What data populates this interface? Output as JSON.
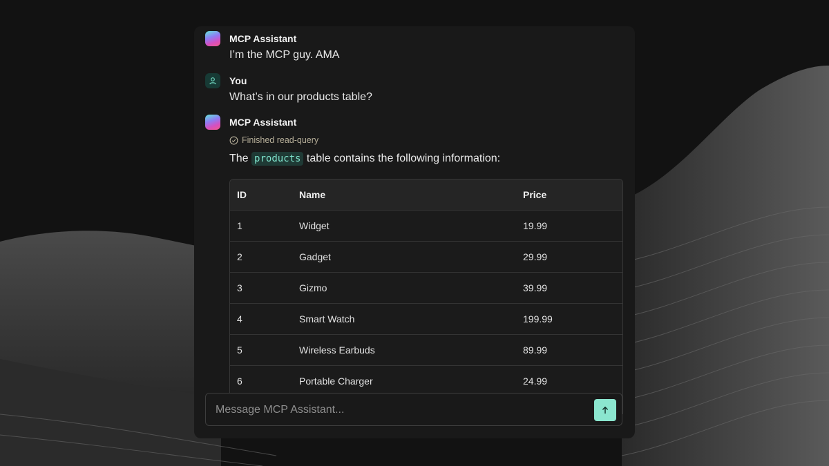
{
  "messages": [
    {
      "sender": "MCP Assistant",
      "text": "I’m the MCP guy. AMA"
    },
    {
      "sender": "You",
      "text": "What’s in our products table?"
    },
    {
      "sender": "MCP Assistant",
      "tool_status": "Finished read-query",
      "intro_before": "The",
      "intro_code": "products",
      "intro_after": "table contains the following information:"
    }
  ],
  "table": {
    "headers": [
      "ID",
      "Name",
      "Price"
    ],
    "rows": [
      [
        "1",
        "Widget",
        "19.99"
      ],
      [
        "2",
        "Gadget",
        "29.99"
      ],
      [
        "3",
        "Gizmo",
        "39.99"
      ],
      [
        "4",
        "Smart Watch",
        "199.99"
      ],
      [
        "5",
        "Wireless Earbuds",
        "89.99"
      ],
      [
        "6",
        "Portable Charger",
        "24.99"
      ]
    ]
  },
  "composer": {
    "placeholder": "Message MCP Assistant..."
  },
  "colors": {
    "accent": "#8be6cf",
    "tool_status": "#b5ad98",
    "code_chip": "#7fe3cc"
  },
  "icons": {
    "bot_avatar": "gradient-logo-icon",
    "user_avatar": "user-icon",
    "tool_status": "check-circle-icon",
    "send": "arrow-up-icon"
  }
}
